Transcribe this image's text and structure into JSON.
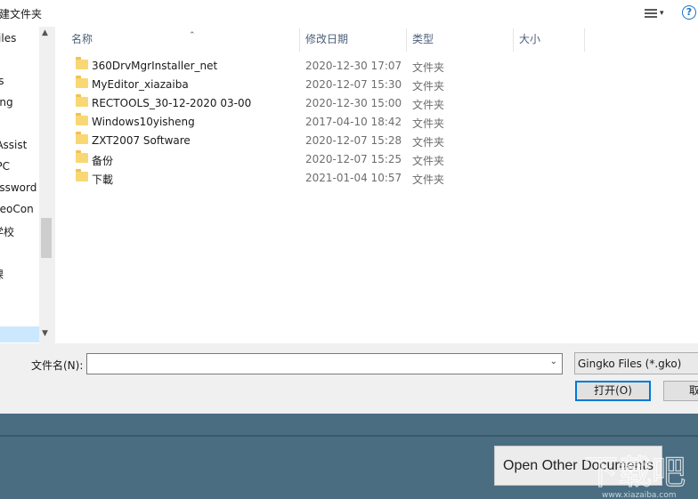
{
  "toolbar": {
    "new_folder": "新建文件夹",
    "view_icon": "view-list-icon",
    "help_icon": "help-icon",
    "help_glyph": "?"
  },
  "nav": {
    "items": [
      "Files",
      "ss",
      "eng",
      "iAssist",
      "iPC",
      "assword",
      "deoCon",
      "学校",
      "课"
    ]
  },
  "file_list": {
    "columns": {
      "name": "名称",
      "modified": "修改日期",
      "type": "类型",
      "size": "大小"
    },
    "rows": [
      {
        "name": "360DrvMgrInstaller_net",
        "modified": "2020-12-30 17:07",
        "type": "文件夹"
      },
      {
        "name": "MyEditor_xiazaiba",
        "modified": "2020-12-07 15:30",
        "type": "文件夹"
      },
      {
        "name": "RECTOOLS_30-12-2020 03-00",
        "modified": "2020-12-30 15:00",
        "type": "文件夹"
      },
      {
        "name": "Windows10yisheng",
        "modified": "2017-04-10 18:42",
        "type": "文件夹"
      },
      {
        "name": "ZXT2007 Software",
        "modified": "2020-12-07 15:28",
        "type": "文件夹"
      },
      {
        "name": "备份",
        "modified": "2020-12-07 15:25",
        "type": "文件夹"
      },
      {
        "name": "下載",
        "modified": "2021-01-04 10:57",
        "type": "文件夹"
      }
    ]
  },
  "bottom": {
    "filename_label": "文件名(N):",
    "filename_value": "",
    "filter_value": "Gingko Files (*.gko)",
    "open_label": "打开(O)",
    "cancel_label": "取"
  },
  "app": {
    "open_other_label": "Open Other Documents"
  },
  "watermark": {
    "text": "下载吧",
    "url": "www.xiazaiba.com"
  }
}
